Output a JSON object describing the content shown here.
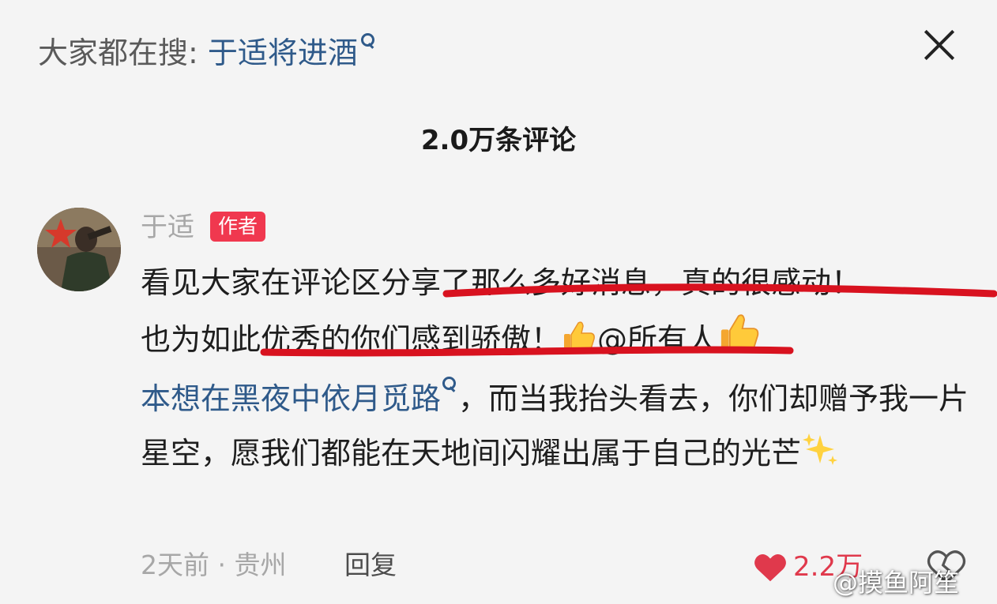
{
  "search_bar": {
    "prefix": "大家都在搜",
    "separator": ":",
    "query": "于适将进酒"
  },
  "comments_header": {
    "count_label": "2.0万条评论"
  },
  "comment": {
    "username": "于适",
    "badge": "作者",
    "line1": "看见大家在评论区分享了那么多好消息，真的很感动！",
    "line2_text": "也为如此优秀的你们感到骄傲！",
    "line2_mention": "@所有人",
    "link_text": "本想在黑夜中依月觅路",
    "rest_text": "，而当我抬头看去，你们却赠予我一片星空，愿我们都能在天地间闪耀出属于自己的光芒",
    "time": "2天前",
    "dot": "·",
    "location": "贵州",
    "reply_label": "回复",
    "like_count": "2.2万"
  },
  "watermark": "@摸鱼阿笙",
  "colors": {
    "link": "#2f5a8a",
    "badge_bg": "#f0384f",
    "like": "#e0394c",
    "annotation": "#d8121f"
  }
}
